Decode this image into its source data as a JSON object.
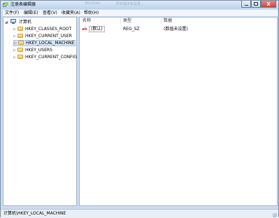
{
  "window": {
    "title": "注册表编辑器",
    "background_title": "Windows",
    "background_text": "所有程序和设置..."
  },
  "menu": [
    "文件(F)",
    "编辑(E)",
    "查看(V)",
    "收藏夹(A)",
    "帮助(H)"
  ],
  "tree": {
    "root": "计算机",
    "items": [
      "HKEY_CLASSES_ROOT",
      "HKEY_CURRENT_USER",
      "HKEY_LOCAL_MACHINE",
      "HKEY_USERS",
      "HKEY_CURRENT_CONFIG"
    ],
    "selected": "HKEY_LOCAL_MACHINE"
  },
  "list": {
    "columns": [
      "名称",
      "类型",
      "数据"
    ],
    "rows": [
      {
        "name": "(默认)",
        "type": "REG_SZ",
        "data": "(数值未设置)",
        "icon": "ab-string-icon"
      }
    ]
  },
  "status": "计算机\\HKEY_LOCAL_MACHINE",
  "colors": {
    "titlebar": "#bcd2ec",
    "close_button": "#c8443a",
    "selection": "#dbe6f3"
  }
}
